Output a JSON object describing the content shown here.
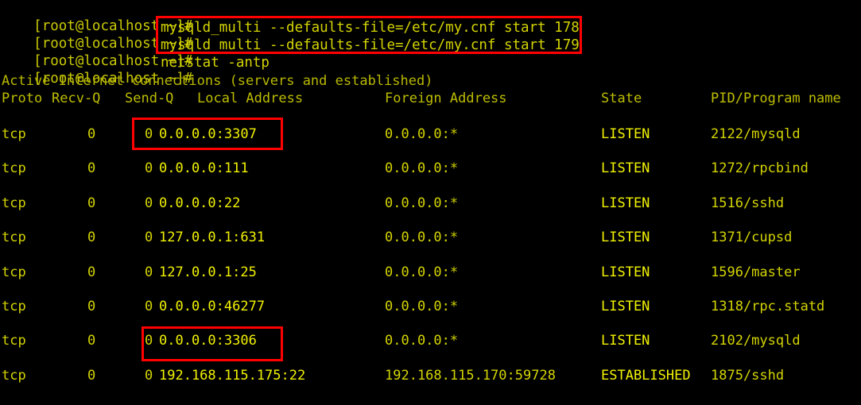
{
  "terminal": {
    "background_color": "#000000",
    "text_color": "#c8c800",
    "bright_text_color": "#f2f200",
    "highlight_color": "#ff0000",
    "prompt": "[root@localhost ~]#",
    "lines": [
      {
        "prompt": "[root@localhost ~]#",
        "command": ""
      },
      {
        "prompt": "[root@localhost ~]#",
        "command": "mysqld_multi --defaults-file=/etc/my.cnf start 178"
      },
      {
        "prompt": "[root@localhost ~]#",
        "command": "mysqld_multi --defaults-file=/etc/my.cnf start 179"
      },
      {
        "prompt": "[root@localhost ~]#",
        "command": "netstat -antp"
      }
    ],
    "output_title": "Active Internet connections (servers and established)",
    "table": {
      "headers": {
        "proto": "Proto",
        "recvq": "Recv-Q",
        "sendq": "Send-Q",
        "local": "Local Address",
        "foreign": "Foreign Address",
        "state": "State",
        "pid": "PID/Program name"
      },
      "rows": [
        {
          "proto": "tcp",
          "recvq": "0",
          "sendq": "0",
          "local": "0.0.0.0:3307",
          "foreign": "0.0.0.0:*",
          "state": "LISTEN",
          "pid": "2122/mysqld",
          "highlighted": true
        },
        {
          "proto": "tcp",
          "recvq": "0",
          "sendq": "0",
          "local": "0.0.0.0:111",
          "foreign": "0.0.0.0:*",
          "state": "LISTEN",
          "pid": "1272/rpcbind",
          "highlighted": false
        },
        {
          "proto": "tcp",
          "recvq": "0",
          "sendq": "0",
          "local": "0.0.0.0:22",
          "foreign": "0.0.0.0:*",
          "state": "LISTEN",
          "pid": "1516/sshd",
          "highlighted": false
        },
        {
          "proto": "tcp",
          "recvq": "0",
          "sendq": "0",
          "local": "127.0.0.1:631",
          "foreign": "0.0.0.0:*",
          "state": "LISTEN",
          "pid": "1371/cupsd",
          "highlighted": false
        },
        {
          "proto": "tcp",
          "recvq": "0",
          "sendq": "0",
          "local": "127.0.0.1:25",
          "foreign": "0.0.0.0:*",
          "state": "LISTEN",
          "pid": "1596/master",
          "highlighted": false
        },
        {
          "proto": "tcp",
          "recvq": "0",
          "sendq": "0",
          "local": "0.0.0.0:46277",
          "foreign": "0.0.0.0:*",
          "state": "LISTEN",
          "pid": "1318/rpc.statd",
          "highlighted": false
        },
        {
          "proto": "tcp",
          "recvq": "0",
          "sendq": "0",
          "local": "0.0.0.0:3306",
          "foreign": "0.0.0.0:*",
          "state": "LISTEN",
          "pid": "2102/mysqld",
          "highlighted": true
        },
        {
          "proto": "tcp",
          "recvq": "0",
          "sendq": "0",
          "local": "192.168.115.175:22",
          "foreign": "192.168.115.170:59728",
          "state": "ESTABLISHED",
          "pid": "1875/sshd",
          "highlighted": false
        }
      ]
    }
  }
}
